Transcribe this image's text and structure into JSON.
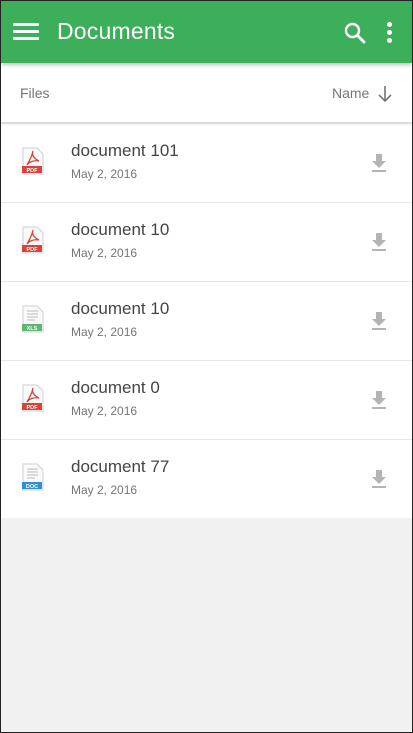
{
  "appbar": {
    "title": "Documents",
    "background": "#3daf5b",
    "icons": {
      "menu": "menu-icon",
      "search": "search-icon",
      "more": "more-vert-icon"
    }
  },
  "subheader": {
    "files_label": "Files",
    "sort_label": "Name",
    "sort_icon": "arrow-down-icon"
  },
  "documents": [
    {
      "name": "document 101",
      "date": "May 2, 2016",
      "type": "PDF"
    },
    {
      "name": "document 10",
      "date": "May 2, 2016",
      "type": "PDF"
    },
    {
      "name": "document 10",
      "date": "May 2, 2016",
      "type": "XLS"
    },
    {
      "name": "document 0",
      "date": "May 2, 2016",
      "type": "PDF"
    },
    {
      "name": "document 77",
      "date": "May 2, 2016",
      "type": "DOC"
    }
  ],
  "type_colors": {
    "PDF": "#d9423b",
    "XLS": "#5fb66f",
    "DOC": "#2f8fd8"
  },
  "download_icon": "download-icon"
}
